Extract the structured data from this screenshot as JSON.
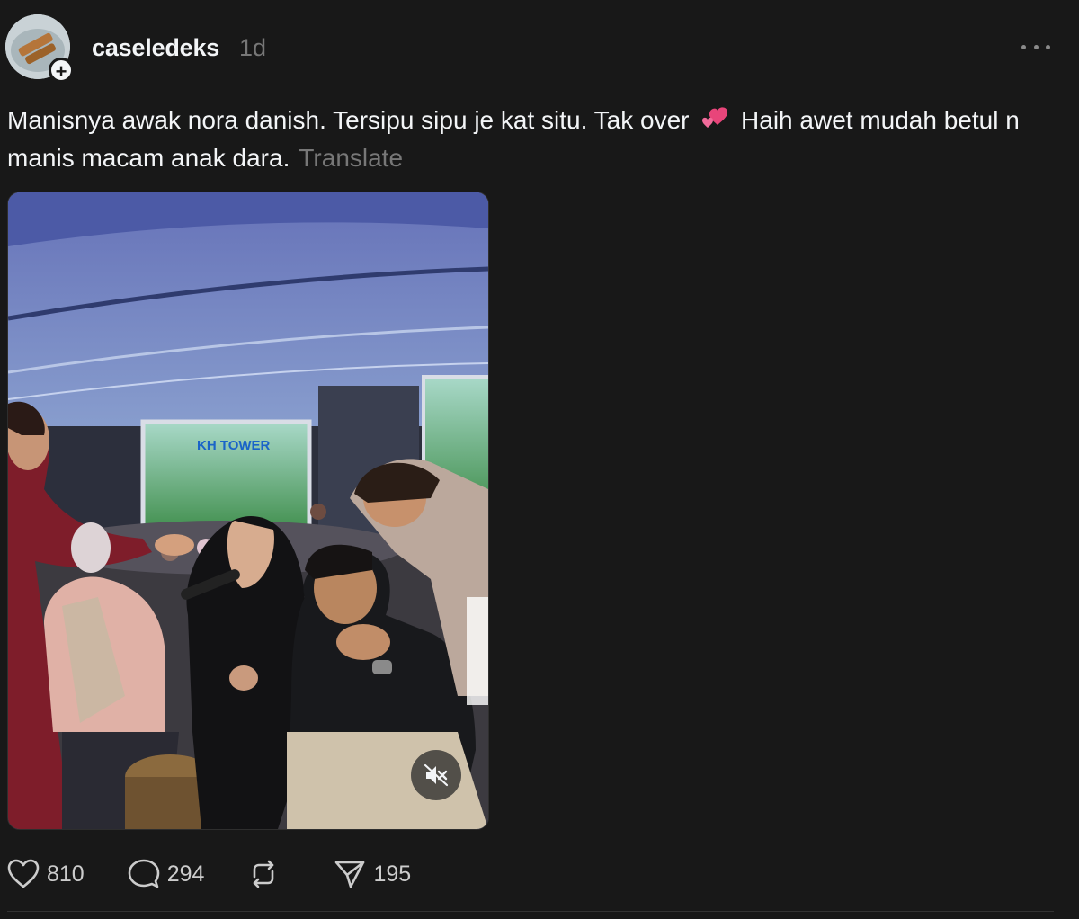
{
  "post": {
    "username": "caseledeks",
    "timestamp": "1d",
    "follow_badge": "+",
    "caption_part1": "Manisnya awak nora danish. Tersipu sipu je kat situ. Tak over ",
    "caption_emoji": "two-hearts-icon",
    "caption_part2": " Haih awet mudah betul n manis macam anak dara.",
    "translate_label": "Translate",
    "media_sign_text": "KH TOWER"
  },
  "actions": {
    "likes": "810",
    "comments": "294",
    "shares": "195"
  },
  "colors": {
    "background": "#181818",
    "text_primary": "#f3f5f7",
    "text_secondary": "#777777",
    "heart_emoji": "#e8457a"
  },
  "icons": [
    "avatar",
    "plus-icon",
    "more-icon",
    "two-hearts-icon",
    "mute-icon",
    "heart-icon",
    "comment-icon",
    "repost-icon",
    "share-icon"
  ]
}
